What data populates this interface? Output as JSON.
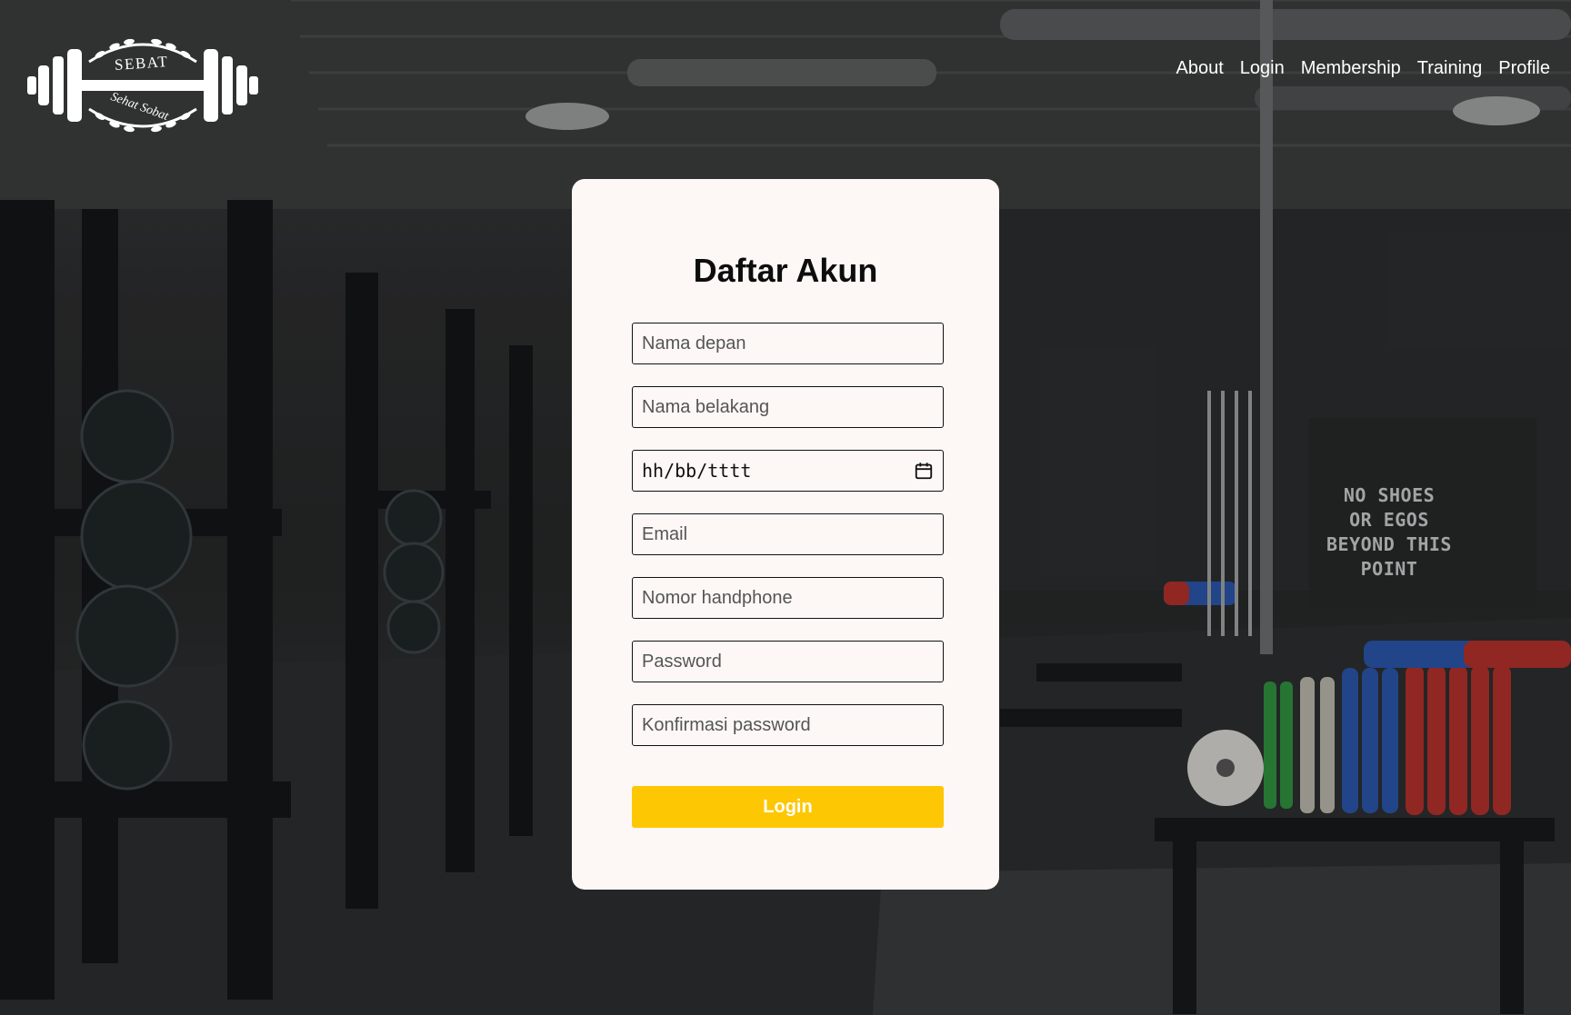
{
  "logo": {
    "top_text": "SEBAT",
    "bottom_text": "Sehat Sobat",
    "icon": "barbell-laurel-icon"
  },
  "nav": {
    "items": [
      {
        "label": "About"
      },
      {
        "label": "Login"
      },
      {
        "label": "Membership"
      },
      {
        "label": "Training"
      },
      {
        "label": "Profile"
      }
    ]
  },
  "background": {
    "sign_lines": [
      "NO SHOES",
      "OR EGOS",
      "BEYOND THIS POINT"
    ]
  },
  "form": {
    "title": "Daftar Akun",
    "fields": {
      "first_name": {
        "placeholder": "Nama depan"
      },
      "last_name": {
        "placeholder": "Nama belakang"
      },
      "birth_date": {
        "value": "hh/bb/tttt",
        "icon": "calendar-icon"
      },
      "email": {
        "placeholder": "Email"
      },
      "phone": {
        "placeholder": "Nomor handphone"
      },
      "password": {
        "placeholder": "Password"
      },
      "confirm_password": {
        "placeholder": "Konfirmasi password"
      }
    },
    "submit_label": "Login"
  },
  "colors": {
    "accent": "#fec703",
    "card_bg": "#fdf8f6",
    "nav_text": "#ffffff"
  }
}
